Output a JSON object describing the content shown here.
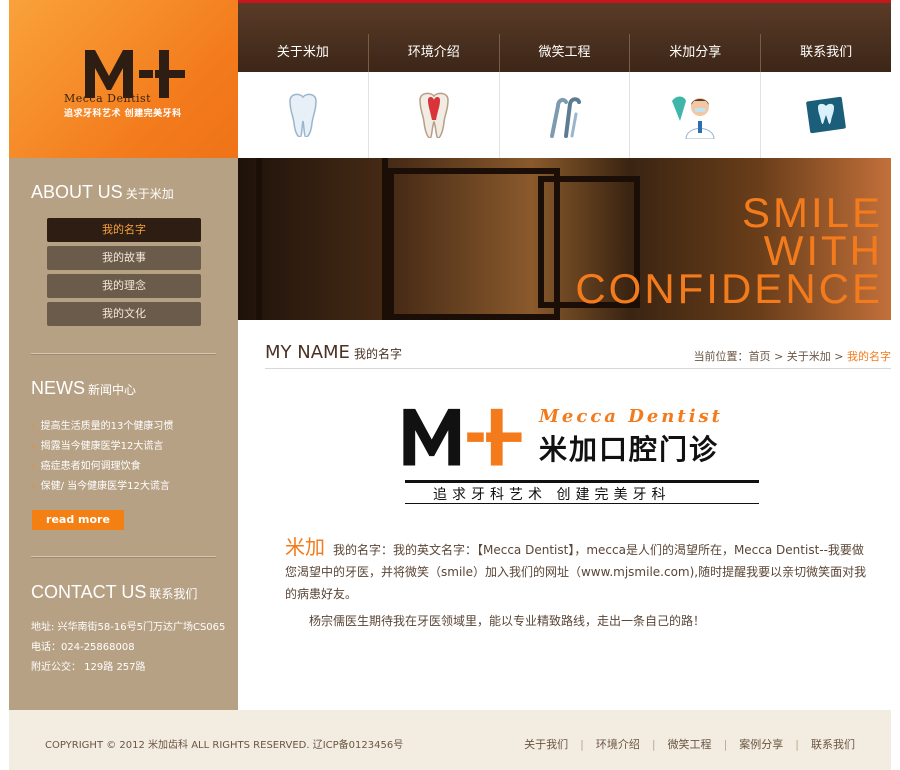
{
  "logo": {
    "en": "Mecca Dentist",
    "slogan": "追求牙科艺术  创建完美牙科",
    "mark_color_dark": "#2d1d12",
    "mark_color_orange": "#f37b1c"
  },
  "nav": {
    "items": [
      "关于米加",
      "环境介绍",
      "微笑工程",
      "米加分享",
      "联系我们"
    ],
    "icons": [
      "tooth-icon",
      "tooth-section-icon",
      "dental-tools-icon",
      "dentist-icon",
      "xray-tooth-icon"
    ]
  },
  "banner": {
    "line1": "SMILE",
    "line2": "WITH",
    "line3": "CONFIDENCE"
  },
  "about": {
    "title_en": "ABOUT US",
    "title_cn": "关于米加",
    "menu": [
      {
        "label": "我的名字",
        "active": true
      },
      {
        "label": "我的故事",
        "active": false
      },
      {
        "label": "我的理念",
        "active": false
      },
      {
        "label": "我的文化",
        "active": false
      }
    ]
  },
  "news": {
    "title_en": "NEWS",
    "title_cn": "新闻中心",
    "items": [
      "提高生活质量的13个健康习惯",
      "揭露当今健康医学12大谎言",
      "癌症患者如何调理饮食",
      "保健/ 当今健康医学12大谎言"
    ],
    "read_more": "read more"
  },
  "contact": {
    "title_en": "CONTACT US",
    "title_cn": "联系我们",
    "address": "地址: 兴华南街58-16号5门万达广场CS065",
    "phone": "电话：024-25868008",
    "bus": "附近公交： 129路 257路"
  },
  "content": {
    "title_en": "MY NAME",
    "title_cn": "我的名字",
    "crumb_prefix": "当前位置：",
    "crumb_home": "首页",
    "crumb_sep": ">",
    "crumb_parent": "关于米加",
    "crumb_current": "我的名字",
    "brand_en": "Mecca Dentist",
    "brand_cn": "米加口腔门诊",
    "brand_slogan": "追求牙科艺术  创建完美牙科",
    "lead": "米加",
    "para1": "我的名字：我的英文名字：【Mecca Dentist】，mecca是人们的渴望所在，Mecca Dentist--我要做您渴望中的牙医，并将微笑（smile）加入我们的网址（www.mjsmile.com),随时提醒我要以亲切微笑面对我的病患好友。",
    "para2": "杨宗儒医生期待我在牙医领域里，能以专业精致路线，走出一条自己的路！"
  },
  "footer": {
    "copyright": "COPYRIGHT © 2012  米加齿科 ALL RIGHTS RESERVED.  辽ICP备0123456号",
    "links": [
      "关于我们",
      "环境介绍",
      "微笑工程",
      "案例分享",
      "联系我们"
    ],
    "sep": "|"
  }
}
